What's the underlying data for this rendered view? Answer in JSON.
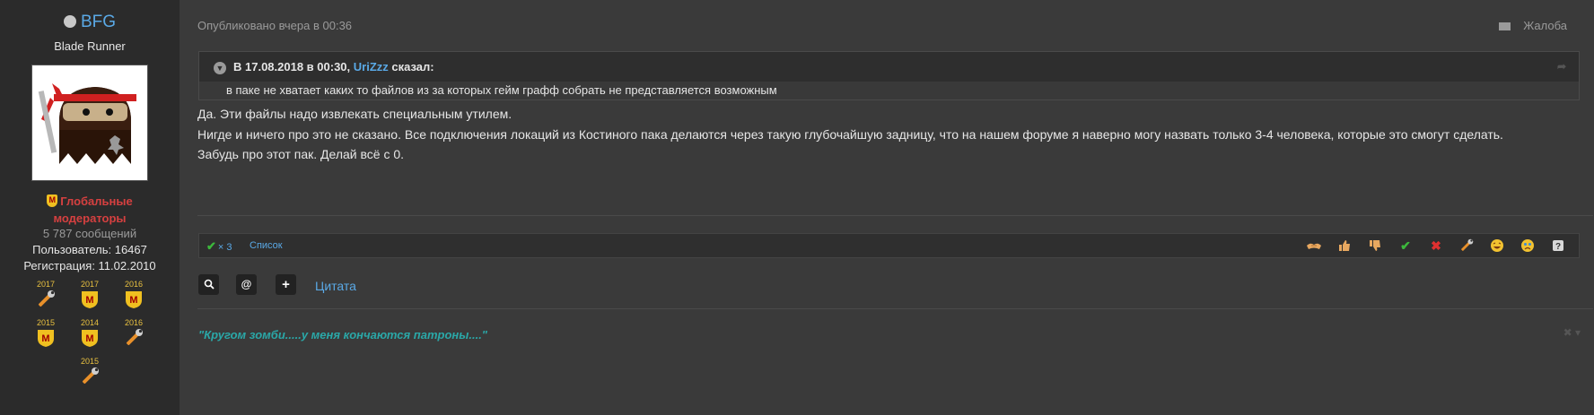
{
  "user": {
    "name": "BFG",
    "title": "Blade Runner",
    "group": "Глобальные модераторы",
    "messages": "5 787 сообщений",
    "user_id": "Пользователь: 16467",
    "registered": "Регистрация: 11.02.2010",
    "awards": [
      {
        "year": "2017",
        "icon": "wrench-icon"
      },
      {
        "year": "2017",
        "icon": "moderator-shield-icon"
      },
      {
        "year": "2016",
        "icon": "moderator-shield-icon"
      },
      {
        "year": "2015",
        "icon": "moderator-shield-icon"
      },
      {
        "year": "2014",
        "icon": "moderator-shield-icon"
      },
      {
        "year": "2016",
        "icon": "wrench-icon"
      },
      {
        "year": "2015",
        "icon": "wrench-icon"
      }
    ]
  },
  "post": {
    "published": "Опубликовано вчера в 00:36",
    "report_label": "Жалоба",
    "quote": {
      "prefix": "В 17.08.2018 в 00:30, ",
      "author": "UriZzz",
      "suffix": " сказал:",
      "text": "в паке не хватает каких то файлов из за которых гейм графф собрать не представляется возможным"
    },
    "lines": [
      "Да. Эти файлы надо извлекать специальным утилем.",
      "Нигде и ничего про это не сказано. Все подключения локаций из Костиного пака делаются через такую глубочайшую задницу, что на нашем форуме я наверно могу назвать только 3-4 человека, которые это смогут сделать.",
      "Забудь про этот пак. Делай всё с 0."
    ],
    "reaction_count": "× 3",
    "reaction_list_label": "Список",
    "reaction_icons": [
      "handshake-icon",
      "thumbs-up-icon",
      "thumbs-down-icon",
      "check-icon",
      "cross-icon",
      "wrench-icon",
      "laugh-icon",
      "cry-icon",
      "help-icon"
    ],
    "quote_action": "Цитата",
    "signature": "\"Кругом зомби.....у меня кончаются патроны....\""
  },
  "colors": {
    "link": "#5aa9e6",
    "moderator": "#d64040",
    "signature": "#2aa8a8",
    "positive": "#3cb83c",
    "negative": "#e03030"
  }
}
